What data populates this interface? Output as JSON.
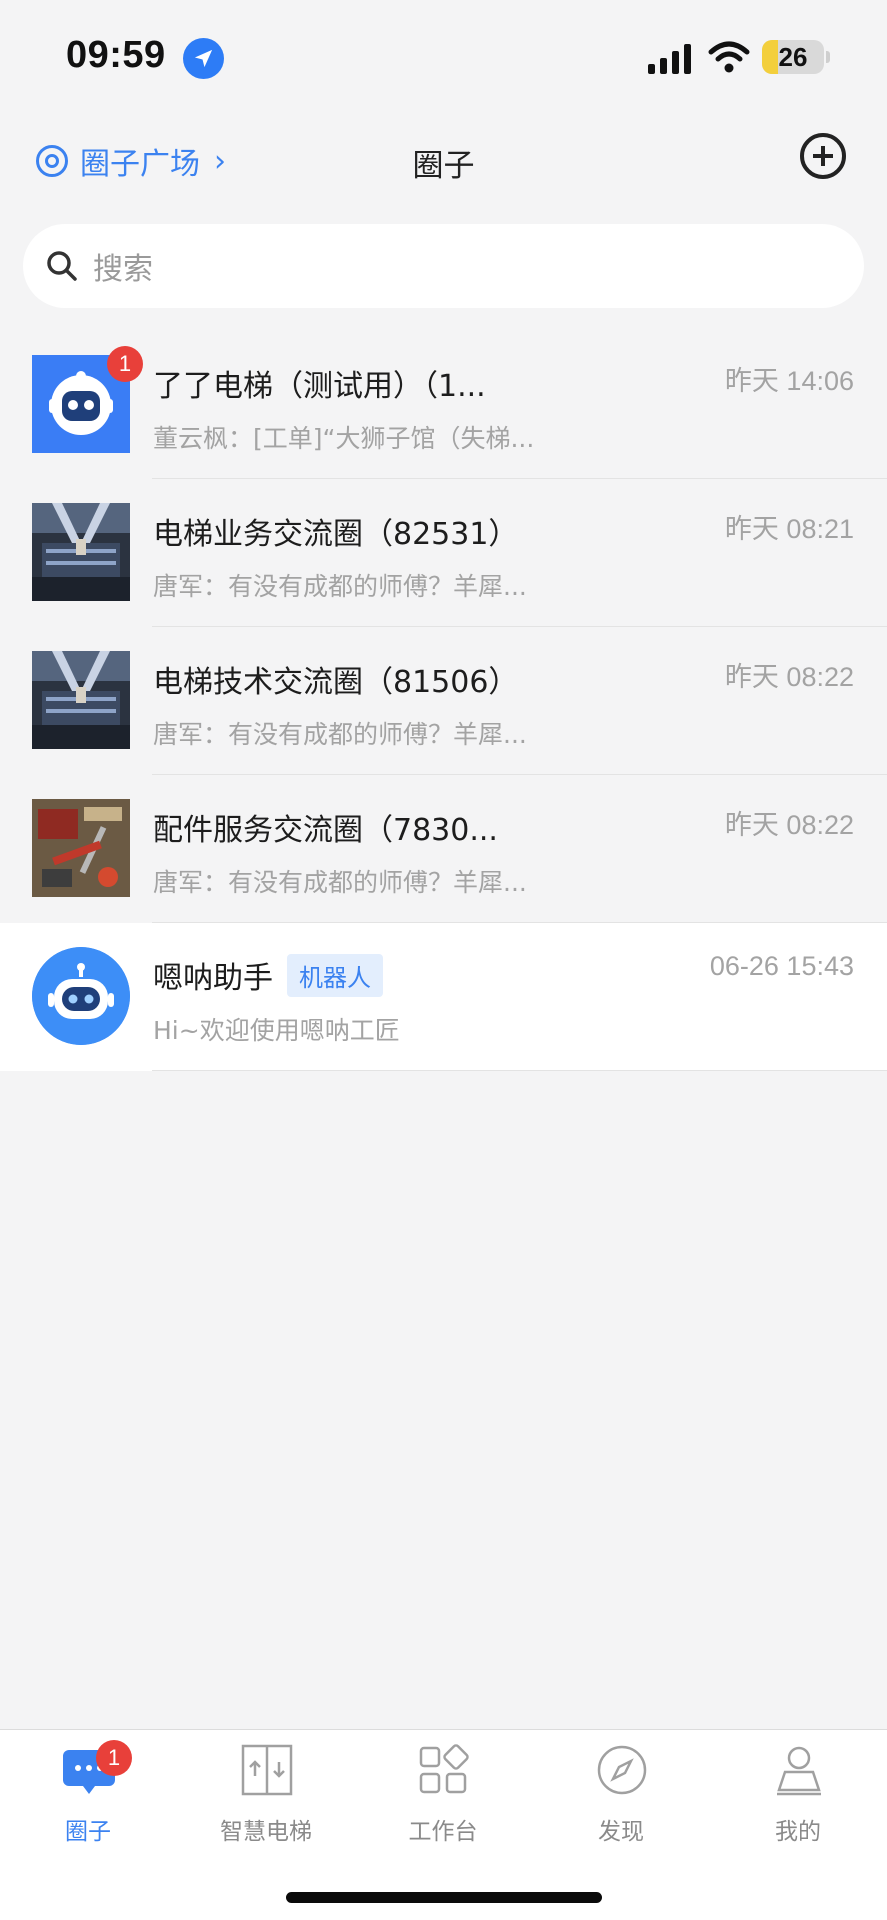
{
  "status_bar": {
    "time": "09:59",
    "battery": "26",
    "battery_level": 0.26
  },
  "header": {
    "plaza_label": "圈子广场",
    "title": "圈子"
  },
  "search": {
    "placeholder": "搜索"
  },
  "chats": [
    {
      "title": "了了电梯（测试用）（1...",
      "time": "昨天 14:06",
      "preview": "董云枫：[工单]“大狮子馆（失梯...",
      "badge": "1",
      "avatar": "robot-square"
    },
    {
      "title": "电梯业务交流圈（82531）",
      "time": "昨天 08:21",
      "preview": "唐军：有没有成都的师傅？羊犀...",
      "avatar": "elevator-photo"
    },
    {
      "title": "电梯技术交流圈（81506）",
      "time": "昨天 08:22",
      "preview": "唐军：有没有成都的师傅？羊犀...",
      "avatar": "elevator-photo"
    },
    {
      "title": "配件服务交流圈（7830...",
      "time": "昨天 08:22",
      "preview": "唐军：有没有成都的师傅？羊犀...",
      "avatar": "tools-photo"
    },
    {
      "title": "嗯呐助手",
      "tag": "机器人",
      "time": "06-26 15:43",
      "preview": "Hi~欢迎使用嗯呐工匠",
      "avatar": "robot-round"
    }
  ],
  "tabs": [
    {
      "label": "圈子",
      "icon": "chat-bubble-icon",
      "active": true,
      "badge": "1"
    },
    {
      "label": "智慧电梯",
      "icon": "elevator-icon"
    },
    {
      "label": "工作台",
      "icon": "workbench-icon"
    },
    {
      "label": "发现",
      "icon": "compass-icon"
    },
    {
      "label": "我的",
      "icon": "profile-icon"
    }
  ],
  "colors": {
    "accent": "#3b82f0",
    "badge": "#e8403a",
    "background": "#f4f4f5"
  }
}
